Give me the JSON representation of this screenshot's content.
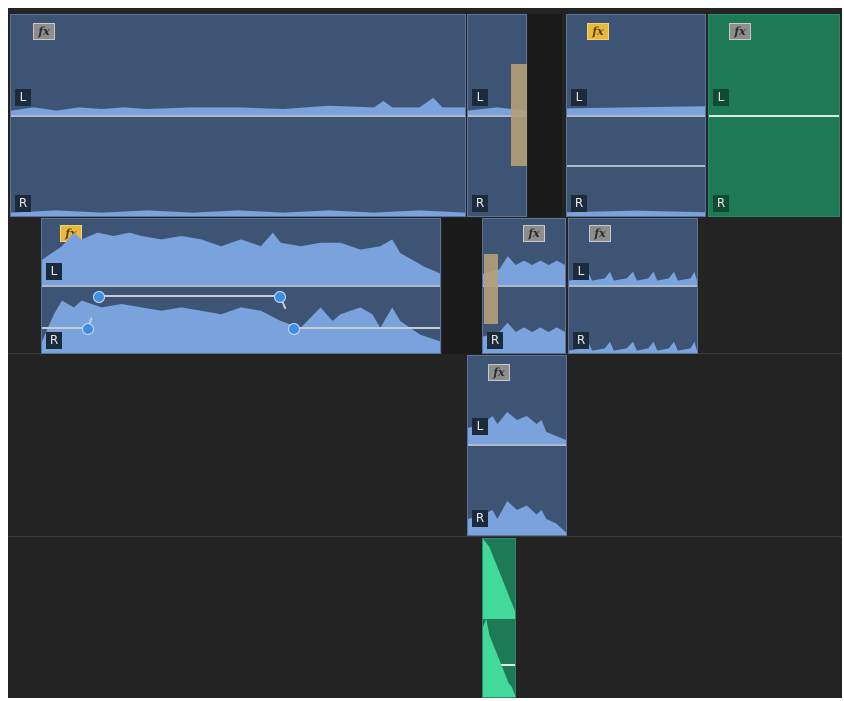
{
  "timeline": {
    "labels": {
      "left": "L",
      "right": "R",
      "fx": "fx"
    },
    "colors": {
      "background": "#232323",
      "audio_clip": "#3d5475",
      "waveform": "#7aa2dc",
      "green_clip": "#1e7a56",
      "green_waveform": "#43d99b",
      "fx_active": "#e8b93a",
      "fx_inactive": "#8d8d8d",
      "keyframe": "#3f8ee0"
    },
    "tracks": [
      {
        "clips": [
          {
            "fx": "inactive"
          },
          {
            "fx": "none"
          },
          {
            "fx": "active"
          },
          {
            "fx": "inactive",
            "color": "green"
          }
        ]
      },
      {
        "clips": [
          {
            "fx": "active",
            "keyframes": 4
          },
          {
            "fx": "inactive"
          },
          {
            "fx": "inactive"
          }
        ]
      },
      {
        "clips": [
          {
            "fx": "inactive"
          }
        ]
      },
      {
        "clips": [
          {
            "fx": "none",
            "color": "green"
          }
        ]
      }
    ]
  }
}
